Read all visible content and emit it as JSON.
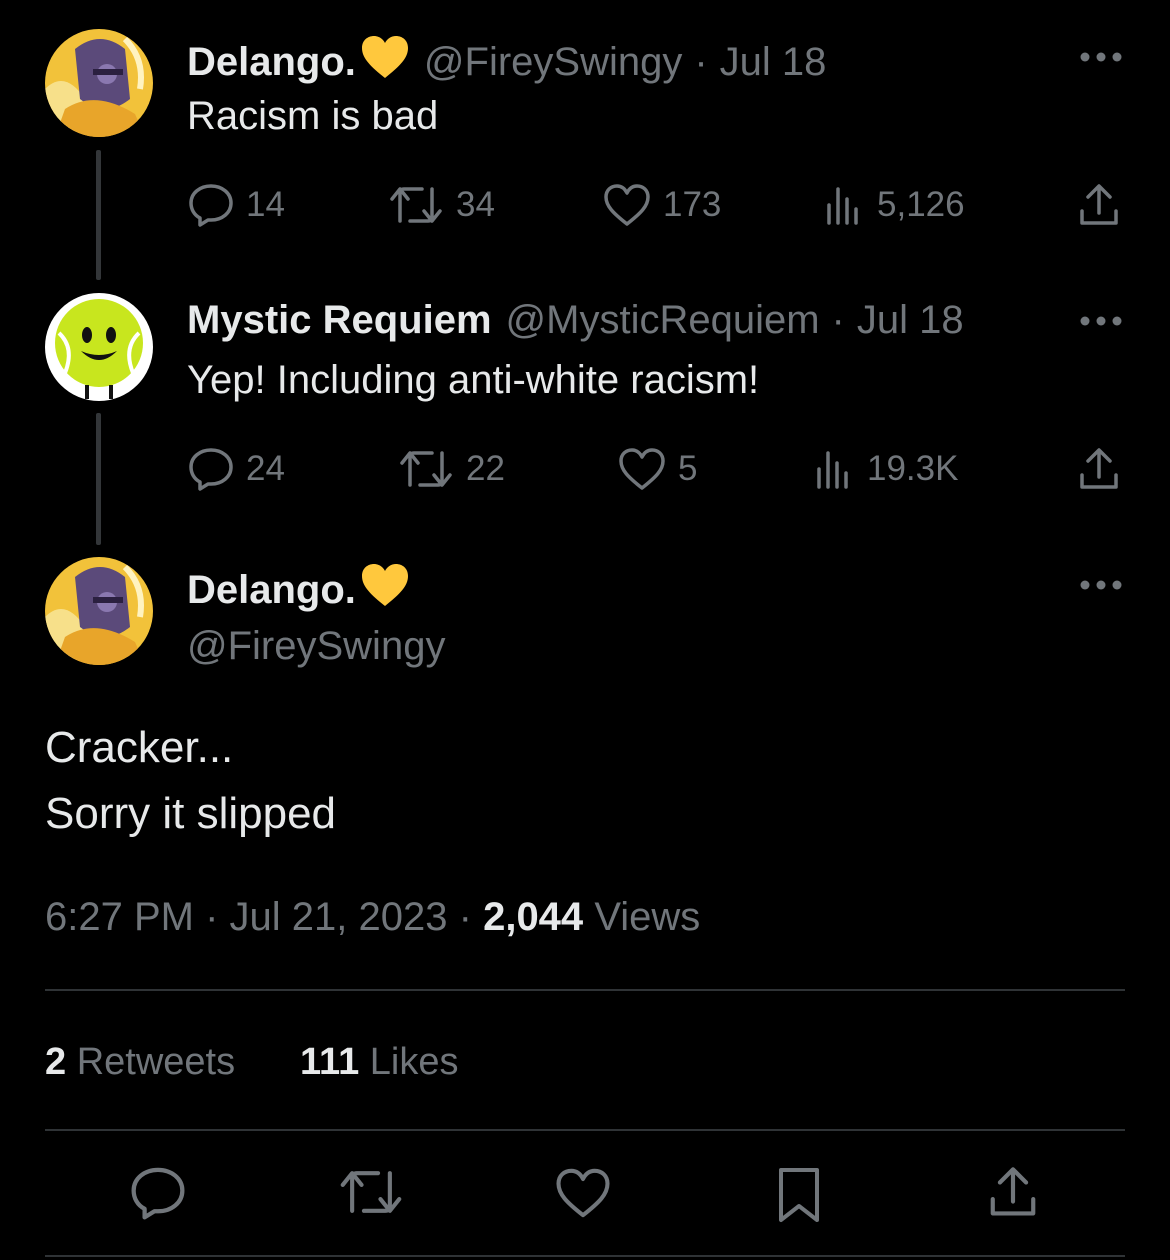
{
  "tweets": [
    {
      "name": "Delango.",
      "handle": "@FireySwingy",
      "separator": "·",
      "date": "Jul 18",
      "text": "Racism is bad",
      "replies": "14",
      "retweets": "34",
      "likes": "173",
      "views": "5,126"
    },
    {
      "name": "Mystic Requiem",
      "handle": "@MysticRequiem",
      "separator": "·",
      "date": "Jul 18",
      "text": "Yep! Including anti-white racism!",
      "replies": "24",
      "retweets": "22",
      "likes": "5",
      "views": "19.3K"
    }
  ],
  "main": {
    "name": "Delango.",
    "handle": "@FireySwingy",
    "text_line1": "Cracker...",
    "text_line2": "Sorry it slipped",
    "time": "6:27 PM",
    "date": "Jul 21, 2023",
    "separator": "·",
    "views_count": "2,044",
    "views_label": "Views",
    "retweets_count": "2",
    "retweets_label": "Retweets",
    "likes_count": "111",
    "likes_label": "Likes"
  },
  "colors": {
    "background": "#000000",
    "text": "#e7e9ea",
    "muted": "#71767b",
    "heart_emoji": "#ffc83d",
    "divider": "#2f3336"
  },
  "icons": [
    "reply-icon",
    "retweet-icon",
    "like-icon",
    "views-icon",
    "share-icon",
    "bookmark-icon",
    "more-icon",
    "yellow-heart-icon"
  ]
}
